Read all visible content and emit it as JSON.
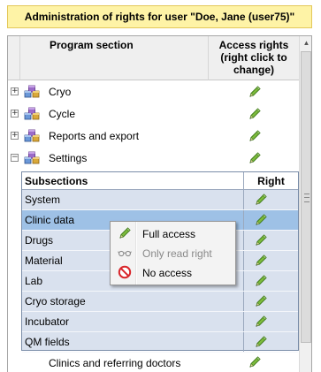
{
  "title": "Administration of rights for user  \"Doe, Jane  (user75)\"",
  "grid": {
    "col_program_section": "Program section",
    "col_access_rights": "Access rights (right click to change)",
    "sections": [
      {
        "label": "Cryo",
        "expander": "+"
      },
      {
        "label": "Cycle",
        "expander": "+"
      },
      {
        "label": "Reports and export",
        "expander": "+"
      },
      {
        "label": "Settings",
        "expander": "−"
      }
    ],
    "last_row_label": "Clinics and referring doctors"
  },
  "subgrid": {
    "col_subsections": "Subsections",
    "col_right": "Right",
    "rows": [
      {
        "label": "System"
      },
      {
        "label": "Clinic data"
      },
      {
        "label": "Drugs"
      },
      {
        "label": "Material"
      },
      {
        "label": "Lab"
      },
      {
        "label": "Cryo storage"
      },
      {
        "label": "Incubator"
      },
      {
        "label": "QM fields"
      }
    ],
    "selected_row": "Clinic data"
  },
  "context_menu": {
    "items": [
      {
        "label": "Full access",
        "icon": "pencil-icon",
        "enabled": true
      },
      {
        "label": "Only read right",
        "icon": "glasses-icon",
        "enabled": false
      },
      {
        "label": "No access",
        "icon": "no-entry-icon",
        "enabled": true
      }
    ]
  },
  "colors": {
    "title_background": "#fef3a6",
    "subgrid_background": "#d9e1ee",
    "selected_row": "#9ec1e6",
    "pencil_green": "#6fae3a",
    "no_access_red": "#d9262b"
  }
}
